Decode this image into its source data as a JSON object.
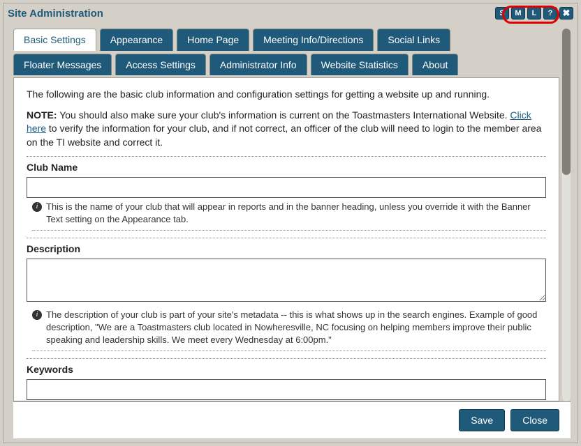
{
  "title": "Site Administration",
  "titleButtons": {
    "s": "S",
    "m": "M",
    "l": "L",
    "help": "?",
    "close": "✖"
  },
  "tabs": {
    "row1": [
      "Basic Settings",
      "Appearance",
      "Home Page",
      "Meeting Info/Directions",
      "Social Links"
    ],
    "row2": [
      "Floater Messages",
      "Access Settings",
      "Administrator Info",
      "Website Statistics",
      "About"
    ]
  },
  "intro": "The following are the basic club information and configuration settings for getting a website up and running.",
  "noteLabel": "NOTE:",
  "noteBefore": " You should also make sure your club's information is current on the Toastmasters International Website. ",
  "noteLink": "Click here",
  "noteAfter": " to verify the information for your club, and if not correct, an officer of the club will need to login to the member area on the TI website and correct it.",
  "fields": {
    "clubName": {
      "label": "Club Name",
      "value": "",
      "help": "This is the name of your club that will appear in reports and in the banner heading, unless you override it with the Banner Text setting on the Appearance tab."
    },
    "description": {
      "label": "Description",
      "value": "",
      "help": "The description of your club is part of your site's metadata -- this is what shows up in the search engines. Example of good description, \"We are a Toastmasters club located in Nowheresville, NC focusing on helping members improve their public speaking and leadership skills. We meet every Wednesday at 6:00pm.\""
    },
    "keywords": {
      "label": "Keywords",
      "value": ""
    }
  },
  "buttons": {
    "save": "Save",
    "close": "Close"
  }
}
